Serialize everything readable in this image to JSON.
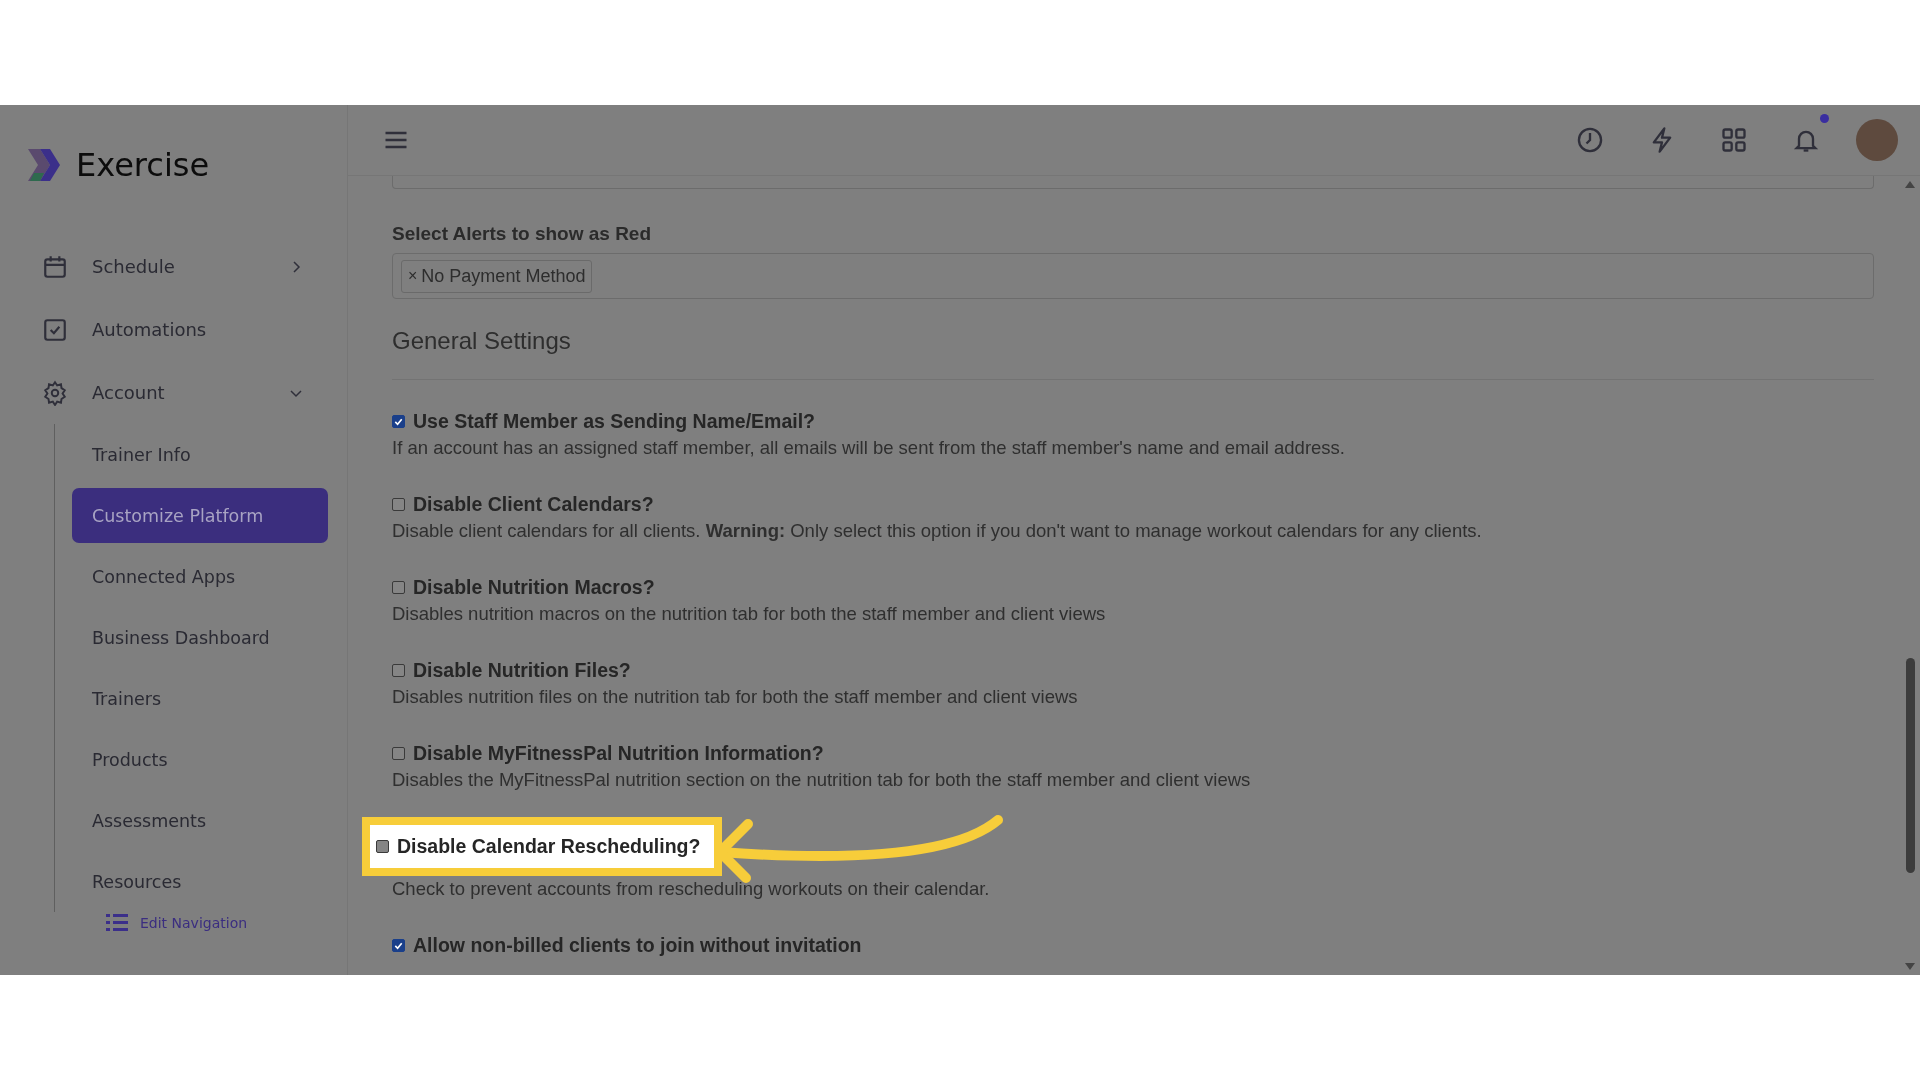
{
  "brand": {
    "name": "Exercise"
  },
  "nav": [
    {
      "label": "Schedule",
      "expanded": false
    },
    {
      "label": "Automations"
    },
    {
      "label": "Account",
      "expanded": true,
      "children": [
        {
          "label": "Trainer Info",
          "selected": false
        },
        {
          "label": "Customize Platform",
          "selected": true
        },
        {
          "label": "Connected Apps",
          "selected": false
        },
        {
          "label": "Business Dashboard",
          "selected": false
        },
        {
          "label": "Trainers",
          "selected": false
        },
        {
          "label": "Products",
          "selected": false
        },
        {
          "label": "Assessments",
          "selected": false
        },
        {
          "label": "Resources",
          "selected": false
        }
      ]
    }
  ],
  "edit_navigation": "Edit Navigation",
  "header": {
    "unread_notifications": true
  },
  "alerts_field": {
    "label": "Select Alerts to show as Red",
    "tags": [
      {
        "remove": "×",
        "label": "No Payment Method"
      }
    ]
  },
  "section_title": "General Settings",
  "settings": [
    {
      "title": "Use Staff Member as Sending Name/Email?",
      "description": "If an account has an assigned staff member, all emails will be sent from the staff member's name and email address.",
      "checked": true,
      "highlighted": false
    },
    {
      "title": "Disable Client Calendars?",
      "description": "Disable client calendars for all clients. **Warning:** Only select this option if you don't want to manage workout calendars for any clients.",
      "checked": false,
      "highlighted": false
    },
    {
      "title": "Disable Nutrition Macros?",
      "description": "Disables nutrition macros on the nutrition tab for both the staff member and client views",
      "checked": false,
      "highlighted": false
    },
    {
      "title": "Disable Nutrition Files?",
      "description": "Disables nutrition files on the nutrition tab for both the staff member and client views",
      "checked": false,
      "highlighted": false
    },
    {
      "title": "Disable MyFitnessPal Nutrition Information?",
      "description": "Disables the MyFitnessPal nutrition section on the nutrition tab for both the staff member and client views",
      "checked": false,
      "highlighted": false
    },
    {
      "title": "Disable Calendar Rescheduling?",
      "description": "Check to prevent accounts from rescheduling workouts on their calendar.",
      "checked": false,
      "highlighted": true
    },
    {
      "title": "Allow non-billed clients to join without invitation",
      "checked": true,
      "highlighted": false
    }
  ]
}
